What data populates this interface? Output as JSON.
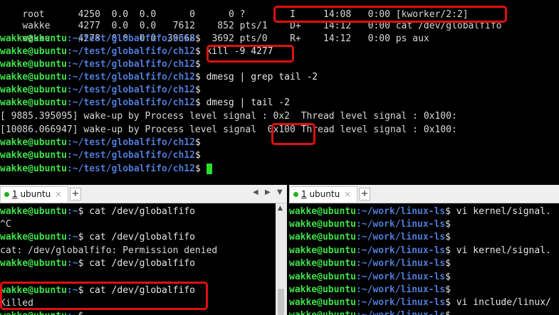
{
  "top": {
    "ps_rows": [
      {
        "user": "root",
        "pid": "4250",
        "cpu": "0.0",
        "mem": "0.0",
        "vsz": "0",
        "rss": "0",
        "tty": "?",
        "stat": "I",
        "start": "14:08",
        "time": "0:00",
        "cmd": "[kworker/2:2]"
      },
      {
        "user": "wakke",
        "pid": "4277",
        "cpu": "0.0",
        "mem": "0.0",
        "vsz": "7612",
        "rss": "852",
        "tty": "pts/1",
        "stat": "D+",
        "start": "14:12",
        "time": "0:00",
        "cmd": "cat /dev/globalfifo"
      },
      {
        "user": "wakke",
        "pid": "4278",
        "cpu": "0.0",
        "mem": "0.0",
        "vsz": "39668",
        "rss": "3692",
        "tty": "pts/0",
        "stat": "R+",
        "start": "14:12",
        "time": "0:00",
        "cmd": "ps aux"
      }
    ],
    "prompt_user": "wakke@ubuntu",
    "prompt_path": ":~/test/globalfifo/ch12",
    "prompt_sym": "$",
    "cmd_kill": " kill -9 4277",
    "cmd_dmesg_grep": " dmesg | grep tail -2",
    "cmd_dmesg_tail": " dmesg | tail -2",
    "dmesg_line1_a": "[ 9885.395095] wake-up by Process level signal : 0x2  Thread level signal : 0x100:",
    "dmesg_line2_a": "[10086.066947] wake-up by Process level signal  ",
    "dmesg_line2_val": "0x100",
    "dmesg_line2_b": " Thread level signal : 0x100:"
  },
  "left_tab": {
    "number": "1",
    "label": " ubuntu",
    "close": "×",
    "plus": "+"
  },
  "right_tab": {
    "number": "1",
    "label": " ubuntu",
    "close": "×",
    "plus": "+"
  },
  "nav": {
    "prev": "◀",
    "next": "▶",
    "menu": "▼"
  },
  "left_pane": {
    "prompt_user": "wakke@ubuntu",
    "prompt_path": ":~",
    "prompt_sym": "$",
    "cmd_cat": " cat /dev/globalfifo",
    "ctrl_c": "^C",
    "perm_denied": "cat: /dev/globalfifo: Permission denied",
    "killed": "Killed"
  },
  "right_pane": {
    "prompt_user": "wakke@ubuntu",
    "prompt_path": ":~/work/linux-ls",
    "prompt_sym": "$",
    "cmd_vi_signal": " vi kernel/signal.",
    "cmd_vi_include": " vi include/linux/"
  }
}
